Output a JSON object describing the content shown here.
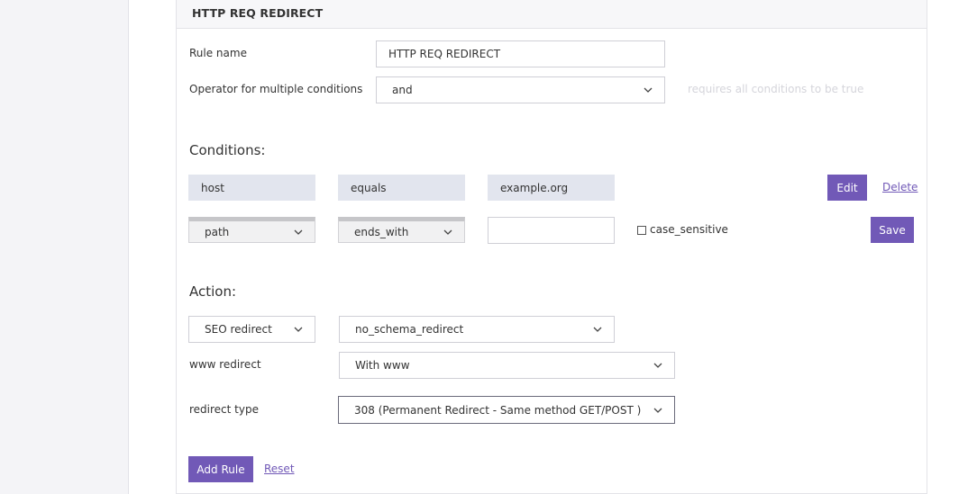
{
  "panel": {
    "title": "HTTP REQ REDIRECT"
  },
  "rule": {
    "name_label": "Rule name",
    "name_value": "HTTP REQ REDIRECT",
    "operator_label": "Operator for multiple conditions",
    "operator_value": "and",
    "operator_hint": "requires all conditions to be true"
  },
  "conditions": {
    "heading": "Conditions:",
    "existing": {
      "field": "host",
      "op": "equals",
      "value": "example.org",
      "edit_label": "Edit",
      "delete_label": "Delete"
    },
    "new": {
      "field": "path",
      "op": "ends_with",
      "value": "",
      "case_label": "case_sensitive",
      "case_checked": false,
      "save_label": "Save"
    }
  },
  "action": {
    "heading": "Action:",
    "type_value": "SEO redirect",
    "subtype_value": "no_schema_redirect",
    "www_label": "www redirect",
    "www_value": "With www",
    "redirect_type_label": "redirect type",
    "redirect_type_value": "308 (Permanent Redirect - Same method GET/POST )"
  },
  "footer": {
    "add_label": "Add Rule",
    "reset_label": "Reset"
  },
  "colors": {
    "accent": "#7159b7",
    "chip": "#e2e5ee",
    "hint": "#d5d5db"
  },
  "icons": {
    "select": "chevron-down-icon"
  }
}
